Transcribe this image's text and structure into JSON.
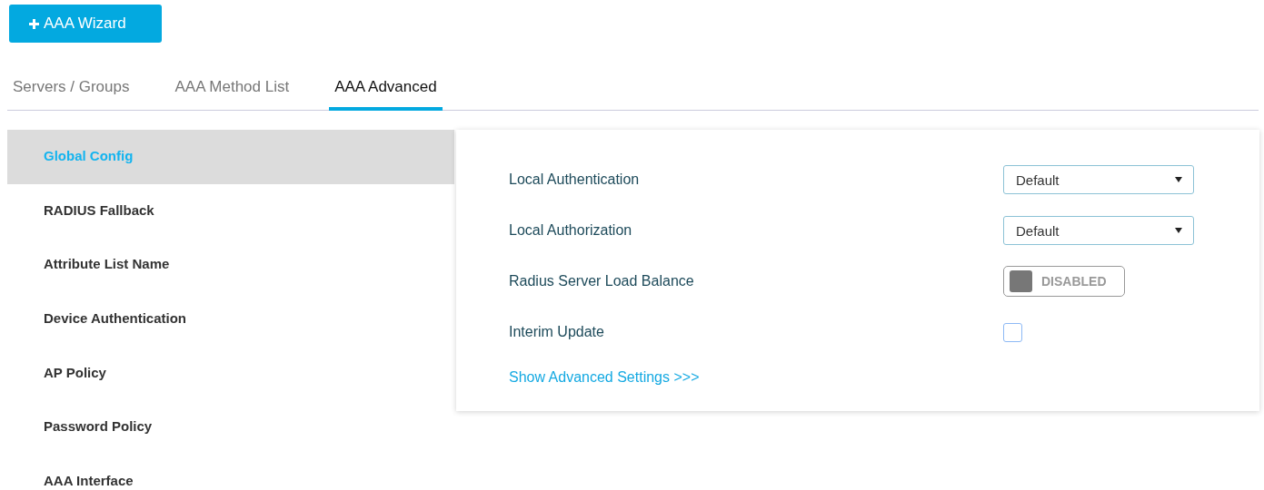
{
  "wizard_button": {
    "label": "AAA Wizard"
  },
  "tabs": [
    {
      "label": "Servers / Groups",
      "selected": false
    },
    {
      "label": "AAA Method List",
      "selected": false
    },
    {
      "label": "AAA Advanced",
      "selected": true
    }
  ],
  "sidebar": {
    "items": [
      {
        "label": "Global Config",
        "selected": true
      },
      {
        "label": "RADIUS Fallback",
        "selected": false
      },
      {
        "label": "Attribute List Name",
        "selected": false
      },
      {
        "label": "Device Authentication",
        "selected": false
      },
      {
        "label": "AP Policy",
        "selected": false
      },
      {
        "label": "Password Policy",
        "selected": false
      },
      {
        "label": "AAA Interface",
        "selected": false
      }
    ]
  },
  "settings": [
    {
      "kind": "select",
      "label": "Local Authentication",
      "value": "Default"
    },
    {
      "kind": "select",
      "label": "Local Authorization",
      "value": "Default"
    },
    {
      "kind": "toggle",
      "label": "Radius Server Load Balance",
      "on": false,
      "state_text": "DISABLED"
    },
    {
      "kind": "checkbox",
      "label": "Interim Update",
      "checked": false
    }
  ],
  "advanced_link": "Show Advanced Settings >>>"
}
